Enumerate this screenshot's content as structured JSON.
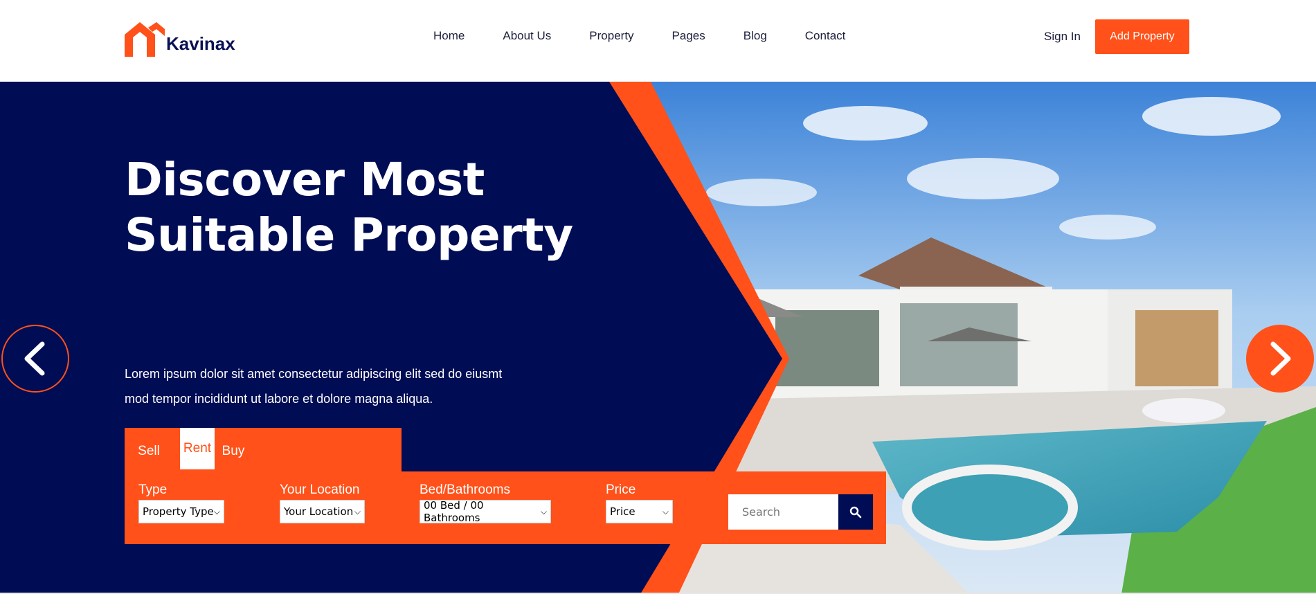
{
  "brand": {
    "name": "Kavinax",
    "accent": "#ff5119",
    "navy": "#000d55"
  },
  "nav": {
    "items": [
      {
        "label": "Home"
      },
      {
        "label": "About Us"
      },
      {
        "label": "Property"
      },
      {
        "label": "Pages"
      },
      {
        "label": "Blog"
      },
      {
        "label": "Contact"
      }
    ],
    "sign_in": "Sign In",
    "add_property": "Add Property"
  },
  "hero": {
    "title_line1": "Discover Most",
    "title_line2": "Suitable Property",
    "description_line1": "Lorem ipsum dolor sit amet consectetur adipiscing elit sed do eiusmt",
    "description_line2": "mod tempor incididunt ut labore et dolore magna aliqua.",
    "prev_icon": "chevron-left-icon",
    "next_icon": "chevron-right-icon"
  },
  "search": {
    "tabs": [
      {
        "label": "Sell"
      },
      {
        "label": "Rent",
        "active": true
      },
      {
        "label": "Buy"
      }
    ],
    "fields": [
      {
        "label": "Type",
        "value": "Property Type"
      },
      {
        "label": "Your Location",
        "value": "Your Location"
      },
      {
        "label": "Bed/Bathrooms",
        "value": "00 Bed / 00 Bathrooms"
      },
      {
        "label": "Price",
        "value": "Price"
      }
    ],
    "placeholder": "Search",
    "search_icon": "search-icon"
  }
}
